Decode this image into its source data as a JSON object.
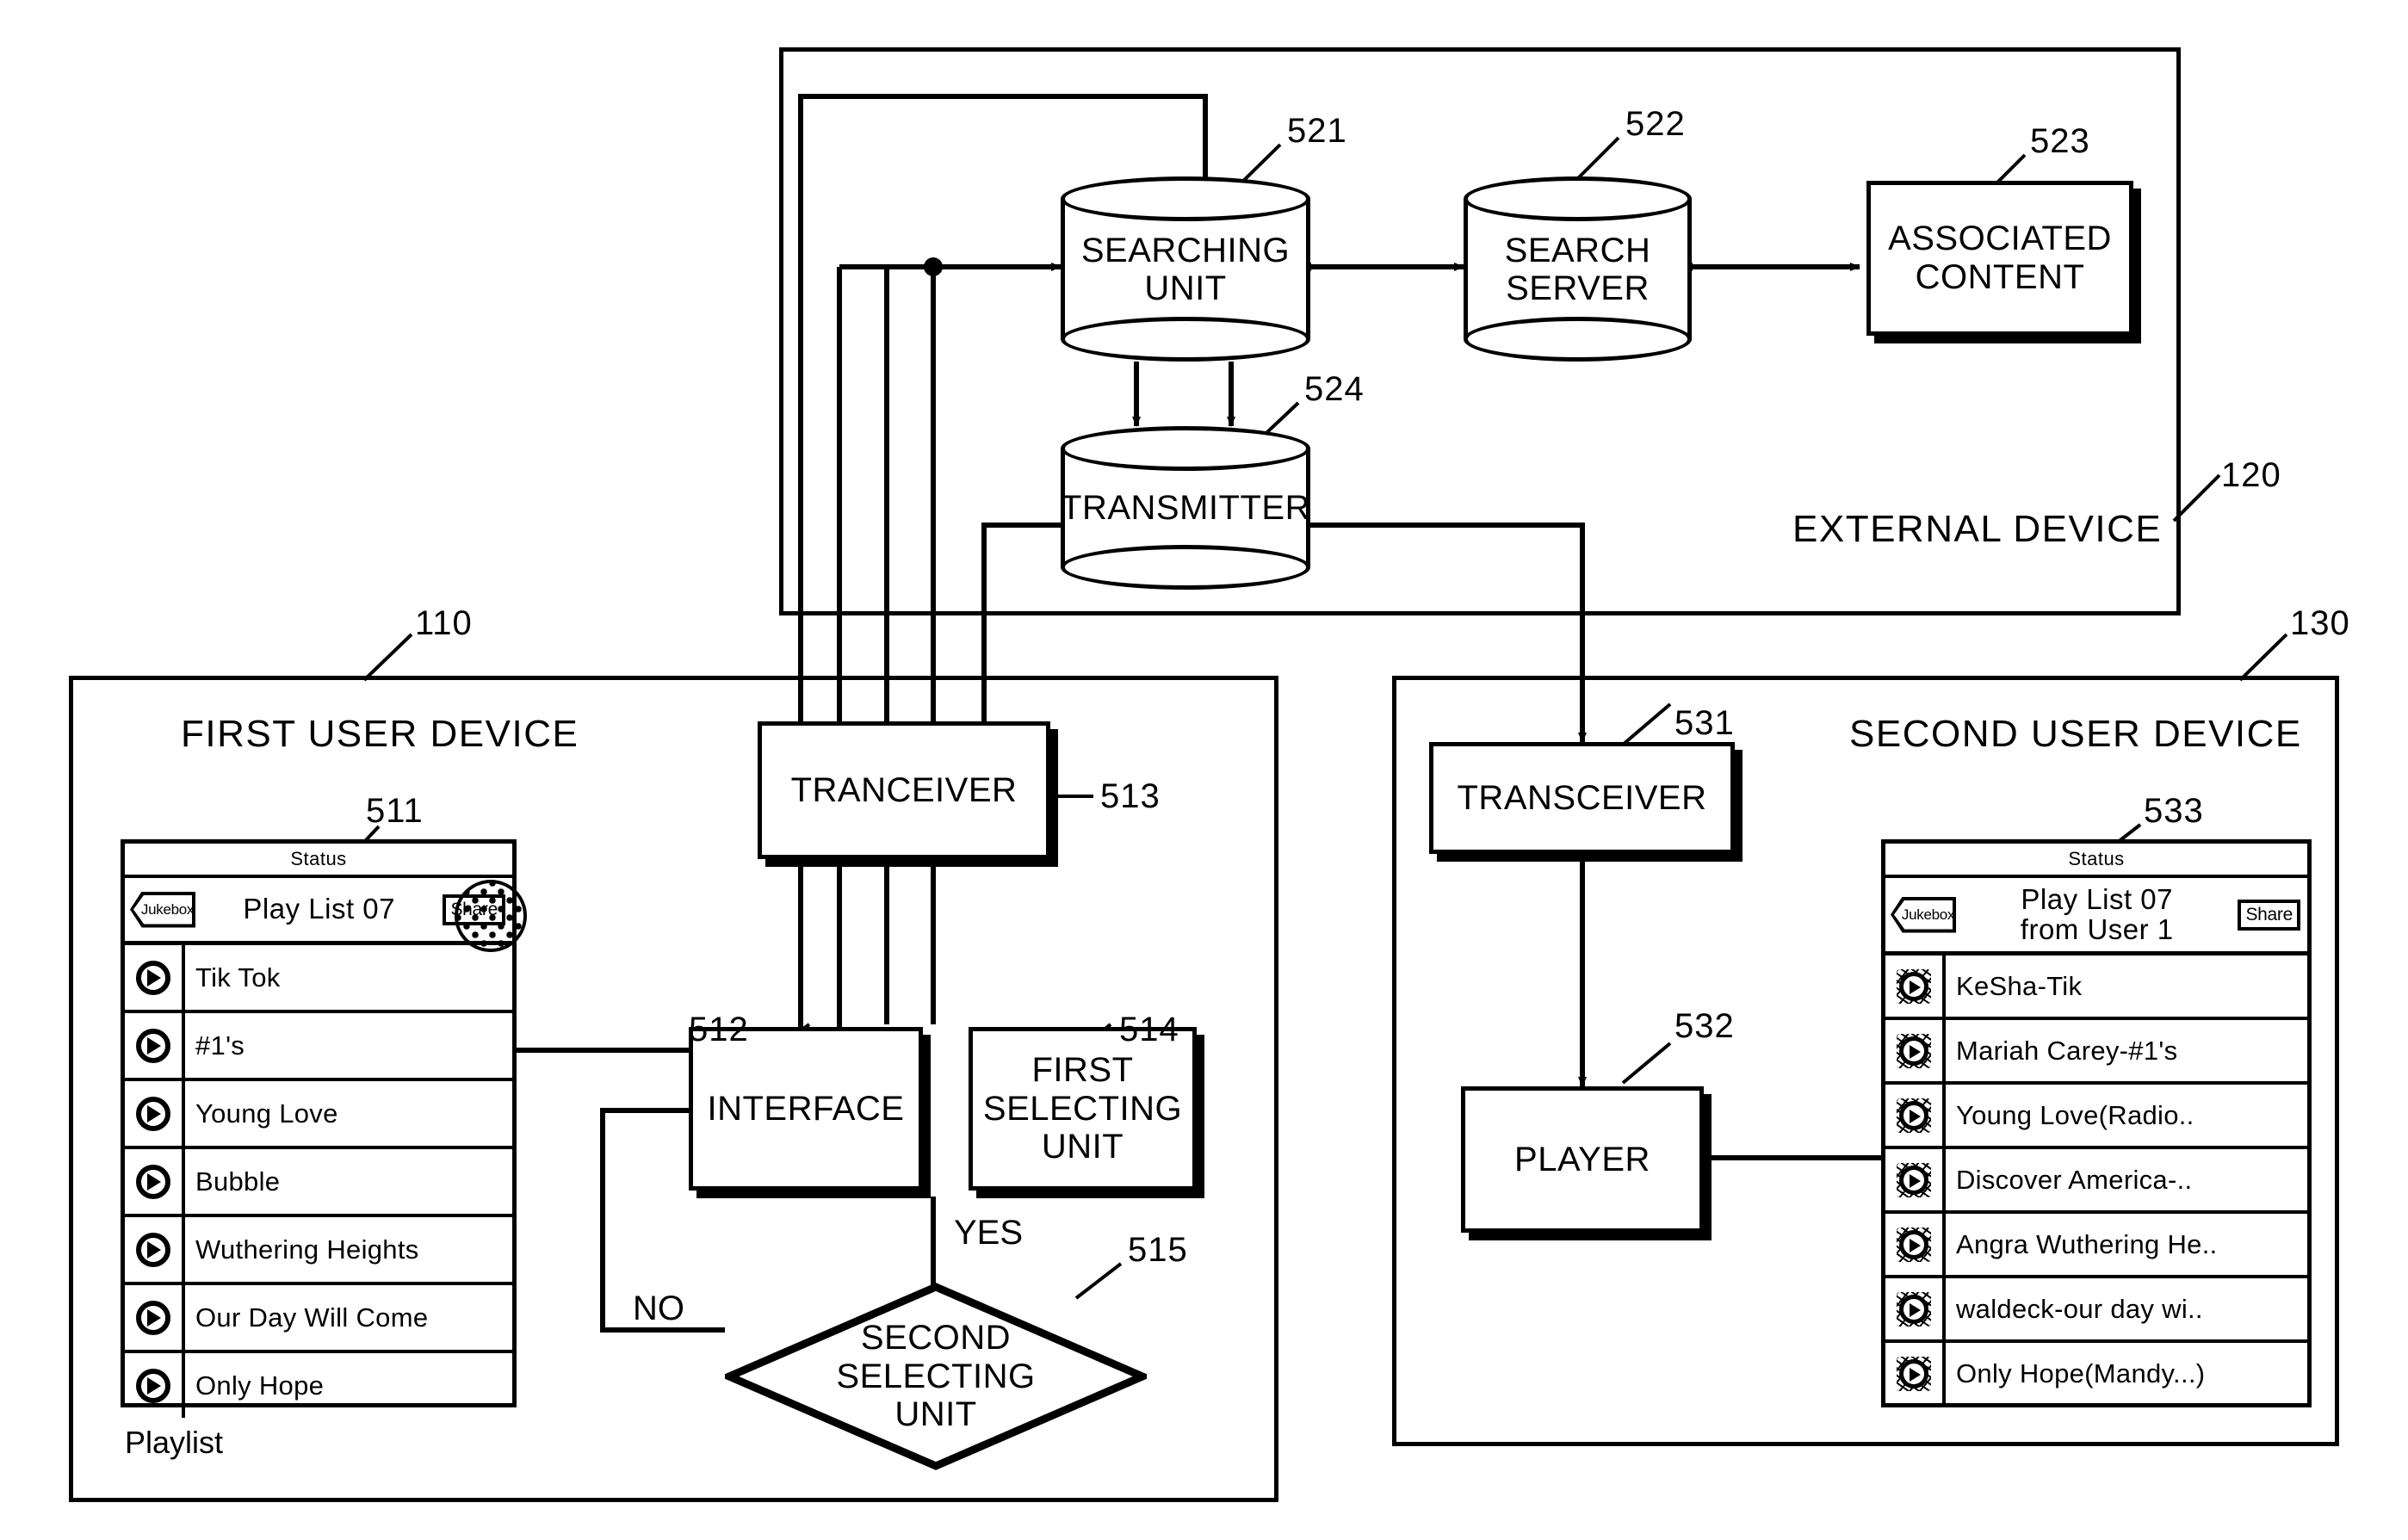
{
  "figure": {
    "external_device": {
      "title": "EXTERNAL DEVICE",
      "ref": "120",
      "blocks": [
        {
          "ref": "521",
          "label": "SEARCHING\nUNIT",
          "shape": "cylinder"
        },
        {
          "ref": "522",
          "label": "SEARCH\nSERVER",
          "shape": "cylinder"
        },
        {
          "ref": "523",
          "label": "ASSOCIATED\nCONTENT",
          "shape": "rect"
        },
        {
          "ref": "524",
          "label": "TRANSMITTER",
          "shape": "cylinder"
        }
      ]
    },
    "first_user_device": {
      "title": "FIRST USER DEVICE",
      "ref": "110",
      "blocks": [
        {
          "ref": "513",
          "label": "TRANCEIVER",
          "shape": "rect"
        },
        {
          "ref": "512",
          "label": "INTERFACE",
          "shape": "rect"
        },
        {
          "ref": "514",
          "label": "FIRST\nSELECTING\nUNIT",
          "shape": "rect"
        },
        {
          "ref": "515",
          "label": "SECOND\nSELECTING\nUNIT",
          "shape": "diamond"
        }
      ],
      "branch_labels": {
        "yes": "YES",
        "no": "NO"
      },
      "playlist_caption": "Playlist",
      "screen": {
        "ref": "511",
        "status_label": "Status",
        "back_button": "Jukebox",
        "title": "Play List 07",
        "share_button": "Share",
        "tracks": [
          "Tik Tok",
          "#1's",
          "Young Love",
          "Bubble",
          "Wuthering Heights",
          "Our Day Will Come",
          "Only Hope"
        ]
      }
    },
    "second_user_device": {
      "title": "SECOND USER DEVICE",
      "ref": "130",
      "blocks": [
        {
          "ref": "531",
          "label": "TRANSCEIVER",
          "shape": "rect"
        },
        {
          "ref": "532",
          "label": "PLAYER",
          "shape": "rect"
        }
      ],
      "screen": {
        "ref": "533",
        "status_label": "Status",
        "back_button": "Jukebox",
        "title_line1": "Play List 07",
        "title_line2": "from User 1",
        "share_button": "Share",
        "tracks": [
          "KeSha-Tik",
          "Mariah Carey-#1's",
          "Young Love(Radio..",
          "Discover America-..",
          "Angra Wuthering He..",
          "waldeck-our day wi..",
          "Only Hope(Mandy...)"
        ]
      }
    }
  }
}
